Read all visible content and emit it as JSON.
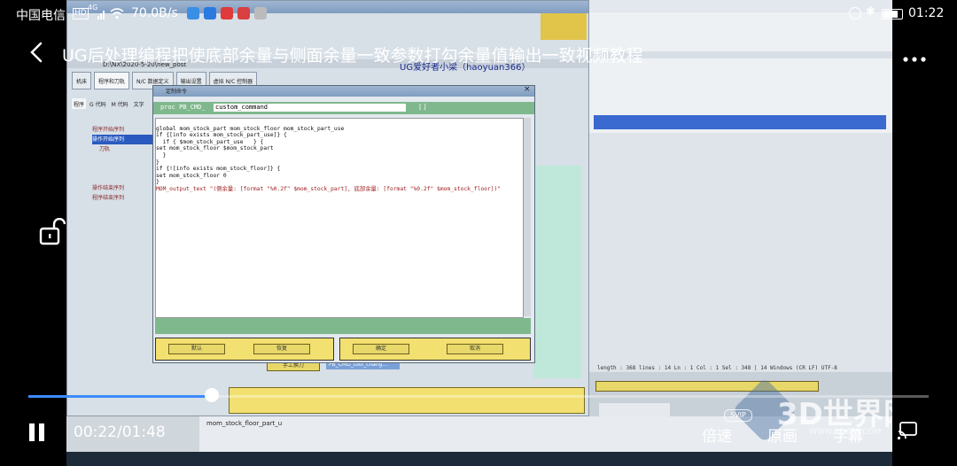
{
  "status_bar": {
    "carrier": "中国电信",
    "network_badge": "HD",
    "signal": "4G",
    "speed": "70.0B/s",
    "time": "01:22"
  },
  "header": {
    "back_icon": "chevron-left-icon",
    "title": "UG后处理编程把使底部余量与侧面余量一致参数打勾余量值输出一致视频教程",
    "more_icon": "more-horizontal-icon"
  },
  "player": {
    "current_time": "00:22/01:48",
    "progress_fraction": 0.2037,
    "speed_label": "倍速",
    "original_label": "原画",
    "subtitle_label": "字幕",
    "lock_icon": "unlock-icon",
    "pause_icon": "pause-icon",
    "cast_icon": "cast-icon"
  },
  "video_content": {
    "window_path": "D:\\NX\\2020-5-20\\new_post",
    "banner": "UG爱好者小梁（haoyuan366）",
    "toolbar_tabs": [
      "机床",
      "程序和刀轨",
      "N/C 数据定义",
      "输出设置",
      "虚拟 N/C 控制器"
    ],
    "left_tabs": [
      "程序",
      "G 代码",
      "M 代码",
      "文字"
    ],
    "tree_items": [
      "程序开始序列",
      "操作开始序列",
      "刀轨",
      "操作结束序列",
      "程序结束序列"
    ],
    "dialog_title": "定制命令",
    "dialog_field_prefix": "proc  PB_CMD_",
    "dialog_field_value": "custom_command",
    "code_lines": [
      "global mom_stock_part mom_stock_floor mom_stock_part_use",
      "",
      "",
      "if {[info exists mom_stock_part_use]} {",
      "  if { $mom_stock_part_use   } {",
      "set mom_stock_floor $mom_stock_part",
      "  }",
      "}",
      "if {![info exists mom_stock_floor]} {",
      "set mom_stock_floor 0",
      "}",
      "MOM_output_text \"(侧余量: [format \"%0.2f\" $mom_stock_part], 底部余量: [format \"%0.2f\" $mom_stock_floor])\""
    ],
    "dialog_buttons": [
      "默认",
      "恢复",
      "确定",
      "取消"
    ],
    "bottom_item": "手工换刀",
    "bottom_item2": "PB_CMD_tool_chang...",
    "editor_status": "length : 368    lines : 14      Ln : 1    Col : 1    Sel : 348 | 14      Windows (CR LF)   UTF-8",
    "bottom_file": "mom_stock_floor_part_u",
    "watermark": "3D世界网",
    "watermark_url": "WWW.3DSJW.COM",
    "watermark_badge": "SVIP"
  }
}
